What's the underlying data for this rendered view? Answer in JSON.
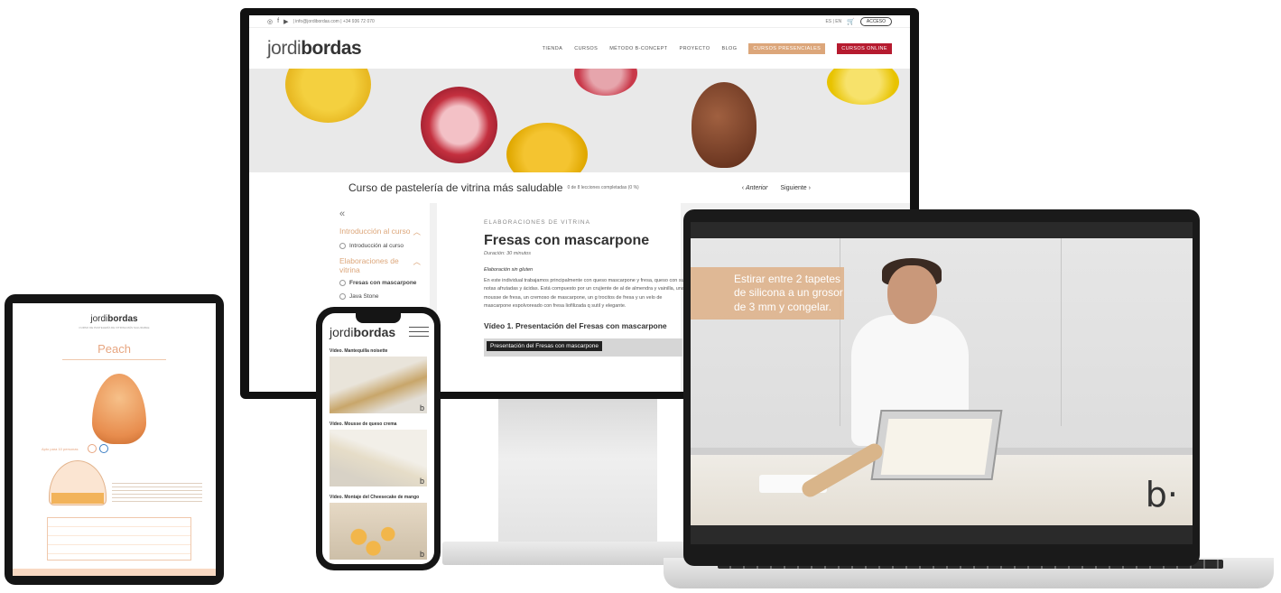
{
  "monitor": {
    "topbar": {
      "contact": "| info@jordibordas.com | +34 936 72 070",
      "lang": "ES | EN",
      "cart_icon": "cart-icon",
      "login_label": "ACCESO"
    },
    "logo": {
      "part1": "jordi",
      "part2": "bordas"
    },
    "nav": {
      "items": [
        "TIENDA",
        "CURSOS",
        "MÉTODO B-CONCEPT",
        "PROYECTO",
        "BLOG"
      ],
      "presencial_label": "CURSOS PRESENCIALES",
      "online_label": "CURSOS ONLINE",
      "presencial_color": "#dca67a",
      "online_color": "#b61b2f"
    },
    "course": {
      "title": "Curso de pastelería de vitrina más saludable",
      "progress": "0 de 8 lecciones completadas (0 %)",
      "prev": "Anterior",
      "next": "Siguiente"
    },
    "sidebar": {
      "collapse_icon": "double-chevron-left-icon",
      "section1": "Introducción al curso",
      "lesson1": "Introducción al curso",
      "section2": "Elaboraciones de vitrina",
      "lesson2": "Fresas con mascarpone",
      "lesson3": "Java Stone"
    },
    "lesson": {
      "category": "ELABORACIONES DE VITRINA",
      "title": "Fresas con mascarpone",
      "duration": "Duración: 30 minutos",
      "subtitle": "Elaboración sin gluten",
      "paragraph": "En este individual trabajamos principalmente con queso mascarpone y fresa, queso con sus notas afrutadas y ácidas. Está compuesto por un crujiente de al de almendra y vainilla, una mousse de fresa, un cremoso de mascarpone, un g trocitos de fresa y un velo de mascarpone espolvoreado con fresa liofilizada q sutil y elegante.",
      "video_heading": "Vídeo 1. Presentación del Fresas con mascarpone",
      "video_label": "Presentación del Fresas con mascarpone"
    }
  },
  "laptop": {
    "overlay_text": "Estirar entre 2 tapetes de silicona a un grosor de 3 mm y congelar.",
    "watermark": "b·"
  },
  "tablet": {
    "logo_part1": "jordi",
    "logo_part2": "bordas",
    "subtitle": "CURSO DE PASTELERÍA DE VITRINA MÁS SALUDABLE",
    "title": "Peach",
    "note": "Apto para 10 personas"
  },
  "phone": {
    "logo_part1": "jordi",
    "logo_part2": "bordas",
    "videos": [
      {
        "title": "Vídeo. Mantequilla noisette"
      },
      {
        "title": "Vídeo. Mousse de queso crema"
      },
      {
        "title": "Vídeo. Montaje del Cheesecake de mango"
      }
    ],
    "watermark": "b"
  }
}
